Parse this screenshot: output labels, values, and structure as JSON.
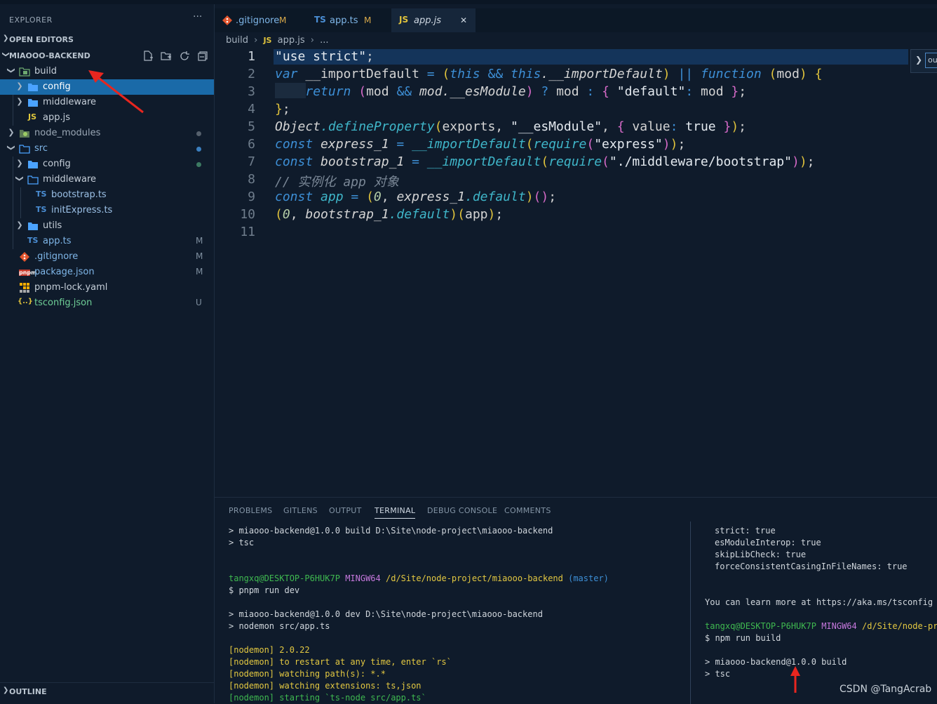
{
  "sidebar": {
    "title": "EXPLORER",
    "more": "···",
    "open_editors": "OPEN EDITORS",
    "project": "MIAOOO-BACKEND",
    "outline": "OUTLINE",
    "tree": [
      {
        "label": "build"
      },
      {
        "label": "config"
      },
      {
        "label": "middleware"
      },
      {
        "label": "app.js",
        "icon": "JS"
      },
      {
        "label": "node_modules"
      },
      {
        "label": "src"
      },
      {
        "label": "config"
      },
      {
        "label": "middleware"
      },
      {
        "label": "bootstrap.ts",
        "icon": "TS"
      },
      {
        "label": "initExpress.ts",
        "icon": "TS"
      },
      {
        "label": "utils"
      },
      {
        "label": "app.ts",
        "icon": "TS",
        "badge": "M"
      },
      {
        "label": ".gitignore",
        "badge": "M"
      },
      {
        "label": "package.json",
        "badge": "M",
        "icon": "pnpm"
      },
      {
        "label": "pnpm-lock.yaml"
      },
      {
        "label": "tsconfig.json",
        "badge": "U",
        "icon": "{..}"
      }
    ]
  },
  "tabs": [
    {
      "label": ".gitignore",
      "mod": "M"
    },
    {
      "label": "app.ts",
      "icon": "TS",
      "mod": "M"
    },
    {
      "label": "app.js",
      "icon": "JS",
      "close": "✕"
    }
  ],
  "breadcrumb": {
    "folder": "build",
    "icon": "JS",
    "file": "app.js",
    "more": "..."
  },
  "find": {
    "value": "ou"
  },
  "line_numbers": [
    "1",
    "2",
    "3",
    "4",
    "5",
    "6",
    "7",
    "8",
    "9",
    "10",
    "11"
  ],
  "panel": {
    "tabs": [
      "PROBLEMS",
      "GITLENS",
      "OUTPUT",
      "TERMINAL",
      "DEBUG CONSOLE",
      "COMMENTS"
    ],
    "left": [
      "> miaooo-backend@1.0.0 build D:\\Site\\node-project\\miaooo-backend",
      "> tsc",
      "tangxq@DESKTOP-P6HUK7P",
      "MINGW64",
      "/d/Site/node-project/miaooo-backend",
      "(master)",
      "$ pnpm run dev",
      "> miaooo-backend@1.0.0 dev D:\\Site\\node-project\\miaooo-backend",
      "> nodemon src/app.ts",
      "[nodemon] 2.0.22",
      "[nodemon] to restart at any time, enter `rs`",
      "[nodemon] watching path(s): *.*",
      "[nodemon] watching extensions: ts,json",
      "[nodemon] starting `ts-node src/app.ts`"
    ],
    "right": [
      "strict: true",
      "esModuleInterop: true",
      "skipLibCheck: true",
      "forceConsistentCasingInFileNames: true",
      "You can learn more at https://aka.ms/tsconfig",
      "tangxq@DESKTOP-P6HUK7P",
      "MINGW64",
      "/d/Site/node-proj",
      "$ npm run build",
      "> miaooo-backend@1.0.0 build",
      "> tsc"
    ]
  },
  "watermark": "CSDN @TangAcrab"
}
